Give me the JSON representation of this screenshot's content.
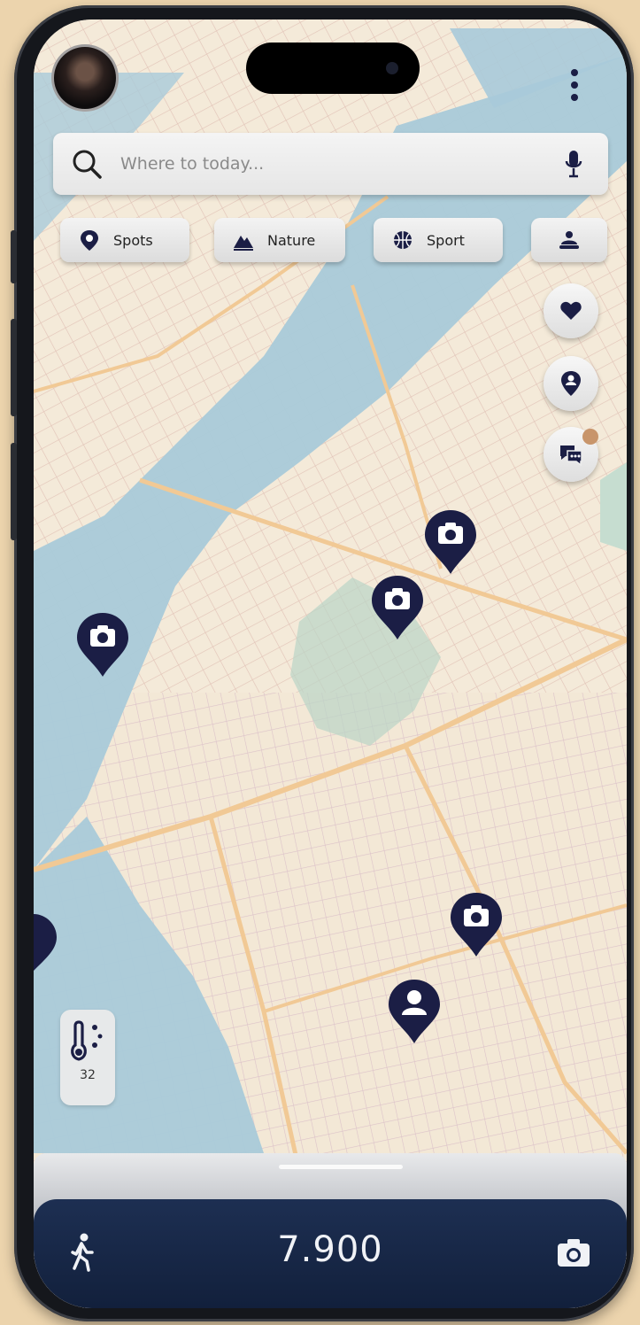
{
  "colors": {
    "pin": "#1b1e45",
    "water": "#a9cad9",
    "land": "#f3e9d8",
    "bottom_bar": "#1a2b4c"
  },
  "search": {
    "placeholder": "Where to today...",
    "left_icon": "search-icon",
    "right_icon": "microphone-icon"
  },
  "categories": [
    {
      "label": "Spots",
      "icon": "location-pin-icon"
    },
    {
      "label": "Nature",
      "icon": "mountain-icon"
    },
    {
      "label": "Sport",
      "icon": "basketball-icon"
    },
    {
      "label": "",
      "icon": "more-categories-icon"
    }
  ],
  "side_buttons": [
    {
      "icon": "heart-icon"
    },
    {
      "icon": "user-pin-icon"
    },
    {
      "icon": "chat-bubbles-icon"
    }
  ],
  "map_pins": [
    {
      "icon": "camera-icon",
      "type": "photo-spot"
    },
    {
      "icon": "camera-icon",
      "type": "photo-spot"
    },
    {
      "icon": "camera-icon",
      "type": "photo-spot"
    },
    {
      "icon": "camera-icon",
      "type": "photo-spot"
    },
    {
      "icon": "person-icon",
      "type": "user-location"
    }
  ],
  "weather": {
    "icon": "thermometer-icon",
    "value": "32"
  },
  "bottom_bar": {
    "steps": "7.900",
    "left_icon": "walking-icon",
    "right_icon": "camera-icon"
  }
}
